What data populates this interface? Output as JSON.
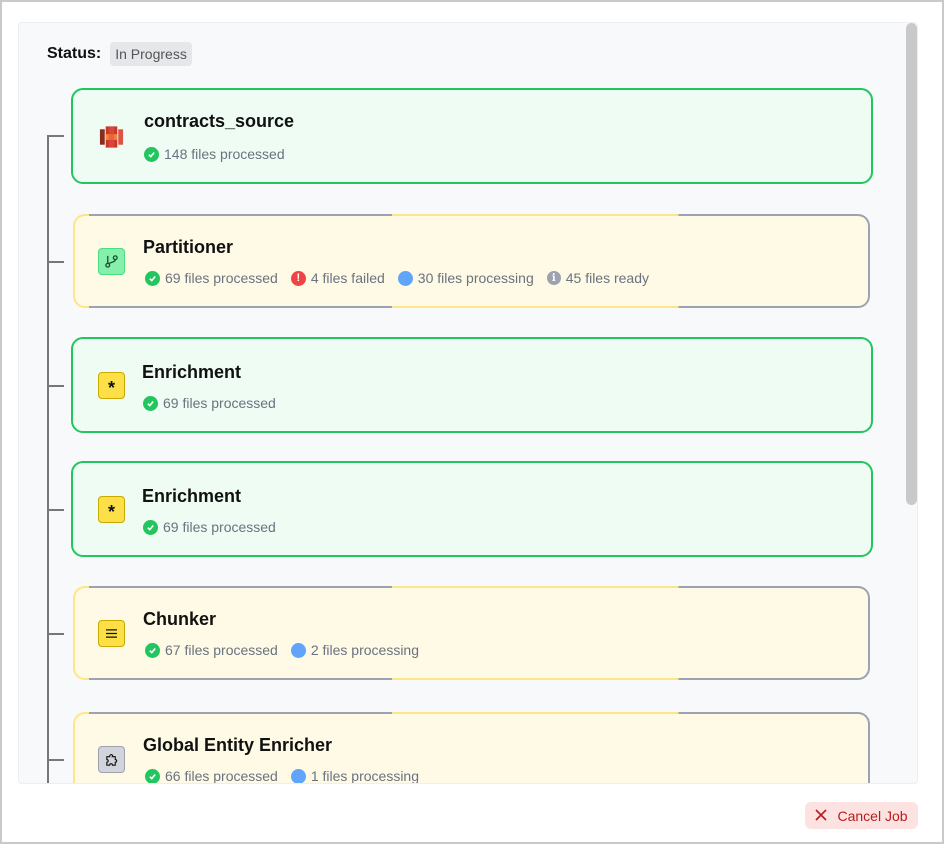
{
  "status": {
    "label": "Status:",
    "value": "In Progress"
  },
  "cards": [
    {
      "title": "contracts_source",
      "icon": "aws-s3-icon",
      "state": "complete",
      "stats": [
        {
          "kind": "success",
          "text": "148 files processed"
        }
      ]
    },
    {
      "title": "Partitioner",
      "icon": "branch-icon",
      "state": "active",
      "stats": [
        {
          "kind": "success",
          "text": "69 files processed"
        },
        {
          "kind": "fail",
          "text": "4 files failed"
        },
        {
          "kind": "processing",
          "text": "30 files processing"
        },
        {
          "kind": "ready",
          "text": "45 files ready"
        }
      ]
    },
    {
      "title": "Enrichment",
      "icon": "asterisk-icon",
      "state": "complete",
      "stats": [
        {
          "kind": "success",
          "text": "69 files processed"
        }
      ]
    },
    {
      "title": "Enrichment",
      "icon": "asterisk-icon",
      "state": "complete",
      "stats": [
        {
          "kind": "success",
          "text": "69 files processed"
        }
      ]
    },
    {
      "title": "Chunker",
      "icon": "menu-lines-icon",
      "state": "active",
      "stats": [
        {
          "kind": "success",
          "text": "67 files processed"
        },
        {
          "kind": "processing",
          "text": "2 files processing"
        }
      ]
    },
    {
      "title": "Global Entity Enricher",
      "icon": "puzzle-icon",
      "state": "active",
      "stats": [
        {
          "kind": "success",
          "text": "66 files processed"
        },
        {
          "kind": "processing",
          "text": "1 files processing"
        }
      ]
    }
  ],
  "cancel_button": {
    "label": "Cancel Job"
  },
  "colors": {
    "success": "#22c55e",
    "fail": "#ef4444",
    "processing": "#60a5fa",
    "ready": "#9ca3af",
    "cancel": "#b91c1c"
  }
}
